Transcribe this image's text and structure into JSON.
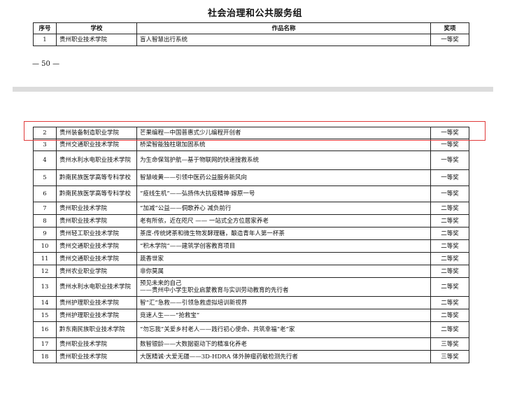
{
  "title": "社会治理和公共服务组",
  "headers": {
    "no": "序号",
    "school": "学校",
    "work": "作品名称",
    "award": "奖项"
  },
  "top_rows": [
    {
      "no": "1",
      "school": "贵州职业技术学院",
      "work": "盲人智慧出行系统",
      "award": "一等奖"
    }
  ],
  "page_number": "— 50 —",
  "rows": [
    {
      "no": "2",
      "school": "贵州装备制造职业学院",
      "work": "芒果编程—中国普惠式少儿编程开创者",
      "award": "一等奖"
    },
    {
      "no": "3",
      "school": "贵州交通职业技术学院",
      "work": "桥梁智能独柱墩加固系统",
      "award": "一等奖"
    },
    {
      "no": "4",
      "school": "贵州水利水电职业技术学院",
      "work": "为生命保驾护航—基于物联网的快速搜救系统",
      "award": "一等奖"
    },
    {
      "no": "5",
      "school": "黔南民族医学高等专科学校",
      "work": "智慧岐黄——引领中医药公益服务新风向",
      "award": "一等奖"
    },
    {
      "no": "6",
      "school": "黔南民族医学高等专科学校",
      "work": "“疫线生机”——弘扬伟大抗疫精神·嫁原一号",
      "award": "一等奖"
    },
    {
      "no": "7",
      "school": "贵州职业技术学院",
      "work": "“加减”公益——侗歌养心 减负前行",
      "award": "二等奖"
    },
    {
      "no": "8",
      "school": "贵州职业技术学院",
      "work": "老有所依，近在咫尺 —— 一站式全方位居家养老",
      "award": "二等奖"
    },
    {
      "no": "9",
      "school": "贵州轻工职业技术学院",
      "work": "茶度-传统烤茶和微生物发酵理糖，酿造青年人第一杯茶",
      "award": "二等奖"
    },
    {
      "no": "10",
      "school": "贵州交通职业技术学院",
      "work": "“积木学院”——建筑学创客教育项目",
      "award": "二等奖"
    },
    {
      "no": "11",
      "school": "贵州交通职业技术学院",
      "work": "蔬香世家",
      "award": "二等奖"
    },
    {
      "no": "12",
      "school": "贵州农业职业学院",
      "work": "非你莫属",
      "award": "二等奖"
    },
    {
      "no": "13",
      "school": "贵州水利水电职业技术学院",
      "work": "预见未来的自己\n——贵州中小学生职业启蒙教育与实训劳动教育的先行者",
      "award": "二等奖"
    },
    {
      "no": "14",
      "school": "贵州护理职业技术学院",
      "work": "智“汇”急救——引领急救虚拟培训新视界",
      "award": "二等奖"
    },
    {
      "no": "15",
      "school": "贵州护理职业技术学院",
      "work": "竞速人生——“抢救宝”",
      "award": "二等奖"
    },
    {
      "no": "16",
      "school": "黔东南民族职业技术学院",
      "work": "“勿忘我”关爱乡村老人——践行初心使命、共筑幸福“老”家",
      "award": "二等奖"
    },
    {
      "no": "17",
      "school": "贵州职业技术学院",
      "work": "数智银龄——大数据驱动下的精准化养老",
      "award": "三等奖"
    },
    {
      "no": "18",
      "school": "贵州职业技术学院",
      "work": "大医精诚·大爱无疆——3D-HDRA 体外肿瘤药敏检测先行者",
      "award": "三等奖"
    }
  ],
  "colors": {
    "highlight": "#e03a3a",
    "band": "#dcdcdc"
  }
}
